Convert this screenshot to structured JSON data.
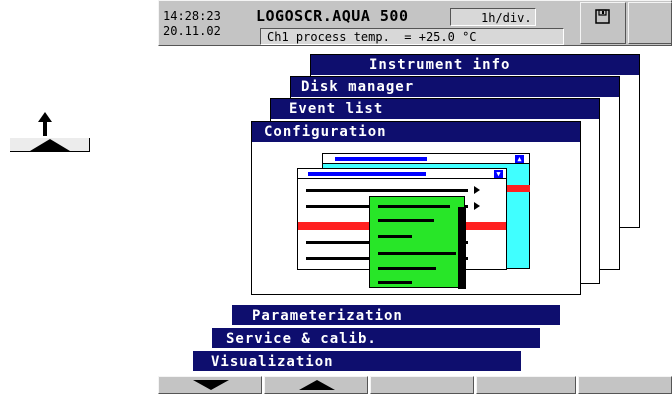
{
  "status_bar": {
    "time": "14:28:23",
    "date": "20.11.02",
    "device_name": "LOGOSCR.AQUA 500",
    "timebase": "1h/div.",
    "channel_readout": "Ch1 process temp.  = +25.0 °C",
    "disk_icon": "floppy-disk-icon"
  },
  "side_scroll": {
    "arrow_icon": "arrow-up-icon"
  },
  "cards": {
    "instrument_info": "Instrument info",
    "disk_manager": "Disk manager",
    "event_list": "Event list",
    "configuration": "Configuration"
  },
  "menu_items": {
    "parameterization": "Parameterization",
    "service_calib": "Service & calib.",
    "visualization": "Visualization"
  },
  "softkeys": {
    "key1_icon": "triangle-down-icon",
    "key2_icon": "triangle-up-icon"
  },
  "colors": {
    "title_bar": "#0e0e6e",
    "green_window": "#28e628",
    "cyan_window": "#40ffff",
    "highlight_red": "#ff2020"
  }
}
